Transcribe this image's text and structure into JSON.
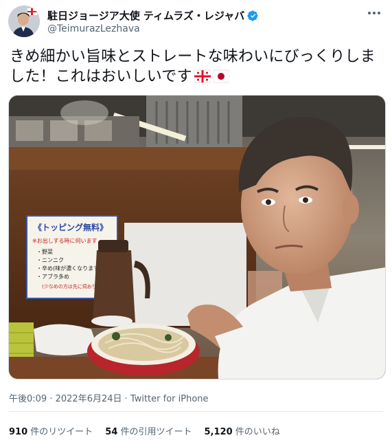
{
  "author": {
    "display_name": "駐日ジョージア大使 ティムラズ・レジャバ",
    "handle": "@TeimurazLezhava",
    "verified": true
  },
  "tweet": {
    "text_line1": "きめ細かい旨味とストレートな味わいにびっくりしま",
    "text_line2": "した！これはおいしいです",
    "emoji": [
      "georgia-flag",
      "japan-flag"
    ]
  },
  "photo": {
    "sign_title": "《トッピング無料》",
    "sign_note": "※お出しする時に伺います",
    "sign_items": [
      "・野菜",
      "・ニンニク",
      "・辛め(味が濃くなります)",
      "・アブラ多め"
    ],
    "sign_footnote": "(少なめの方は先に伺おり..."
  },
  "meta": {
    "time": "午後0:09",
    "date": "2022年6月24日",
    "source": "Twitter for iPhone",
    "sep": " · "
  },
  "stats": {
    "retweets_count": "910",
    "retweets_label": " 件のリツイート",
    "quotes_count": "54",
    "quotes_label": " 件の引用ツイート",
    "likes_count": "5,120",
    "likes_label": " 件のいいね"
  },
  "colors": {
    "text": "#0f1419",
    "secondary": "#536471",
    "verified": "#1d9bf0"
  }
}
